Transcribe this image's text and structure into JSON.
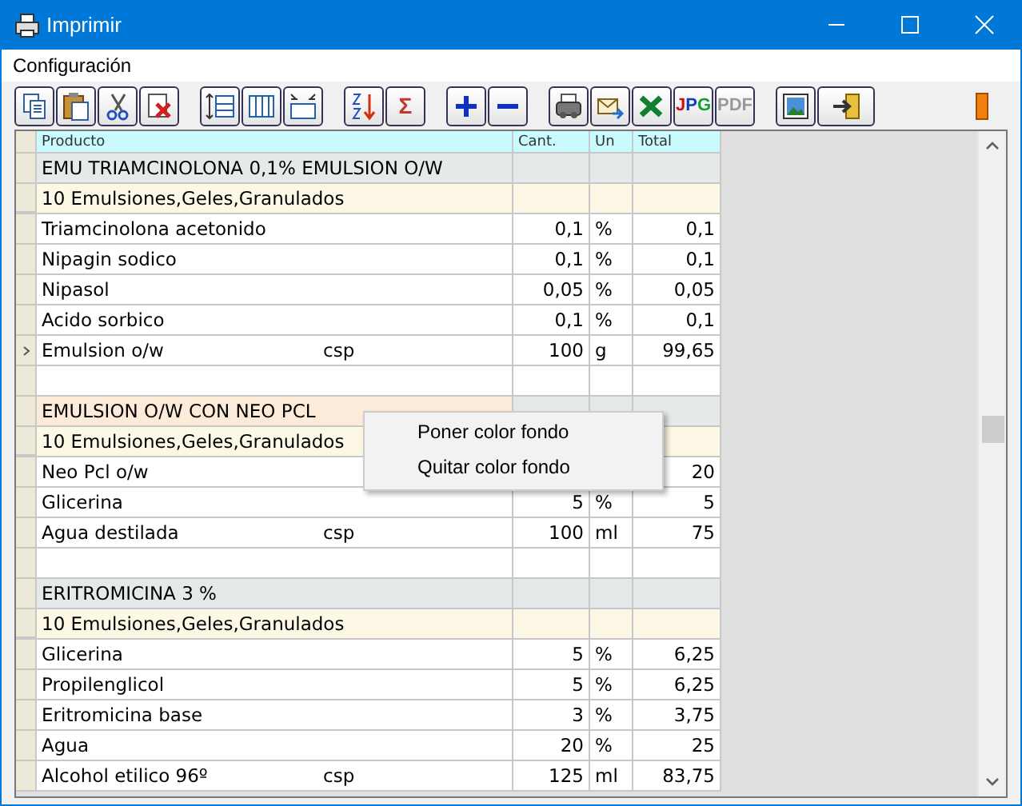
{
  "window": {
    "title": "Imprimir"
  },
  "menu": [
    {
      "label": "Configuración"
    }
  ],
  "toolbar": [
    {
      "buttons": [
        {
          "kind": "copy"
        },
        {
          "kind": "paste"
        },
        {
          "kind": "cut"
        },
        {
          "kind": "delete"
        }
      ]
    },
    {
      "buttons": [
        {
          "kind": "row-height"
        },
        {
          "kind": "columns"
        },
        {
          "kind": "fit"
        }
      ]
    },
    {
      "buttons": [
        {
          "kind": "sort"
        },
        {
          "kind": "sum",
          "label": "Σ"
        }
      ]
    },
    {
      "buttons": [
        {
          "kind": "plus"
        },
        {
          "kind": "minus"
        }
      ]
    },
    {
      "buttons": [
        {
          "kind": "printer"
        },
        {
          "kind": "mail"
        },
        {
          "kind": "excel"
        },
        {
          "kind": "jpg",
          "label": "JPG"
        },
        {
          "kind": "pdf",
          "label": "PDF"
        }
      ]
    },
    {
      "buttons": [
        {
          "kind": "image"
        },
        {
          "kind": "exit"
        }
      ]
    }
  ],
  "table": {
    "columns": [
      "Producto",
      "Cant.",
      "Un",
      "Total"
    ],
    "rows": [
      {
        "kind": "title",
        "product": "EMU TRIAMCINOLONA 0,1% EMULSION O/W",
        "color": "#e6e9e9"
      },
      {
        "kind": "category",
        "product": "10 Emulsiones,Geles,Granulados"
      },
      {
        "kind": "item",
        "product": "Triamcinolona acetonido",
        "qty": "0,1",
        "unit": "%",
        "total": "0,1",
        "current": false
      },
      {
        "kind": "item",
        "product": "Nipagin sodico",
        "qty": "0,1",
        "unit": "%",
        "total": "0,1",
        "current": false
      },
      {
        "kind": "item",
        "product": "Nipasol",
        "qty": "0,05",
        "unit": "%",
        "total": "0,05",
        "current": false
      },
      {
        "kind": "item",
        "product": "Acido sorbico",
        "qty": "0,1",
        "unit": "%",
        "total": "0,1",
        "current": false
      },
      {
        "kind": "item",
        "product": "Emulsion o/w",
        "note": "csp",
        "qty": "100",
        "unit": "g",
        "total": "99,65",
        "current": true
      },
      {
        "kind": "blank"
      },
      {
        "kind": "title",
        "product": "EMULSION O/W CON NEO PCL",
        "color": "#fdebd9"
      },
      {
        "kind": "category",
        "product": "10 Emulsiones,Geles,Granulados"
      },
      {
        "kind": "item",
        "product": "Neo Pcl o/w",
        "total": "20",
        "current": false
      },
      {
        "kind": "item",
        "product": "Glicerina",
        "qty": "5",
        "unit": "%",
        "total": "5",
        "current": false
      },
      {
        "kind": "item",
        "product": "Agua destilada",
        "note": "csp",
        "qty": "100",
        "unit": "ml",
        "total": "75",
        "current": false
      },
      {
        "kind": "blank"
      },
      {
        "kind": "title",
        "product": "ERITROMICINA 3 %",
        "color": "#e6e9e9"
      },
      {
        "kind": "category",
        "product": "10 Emulsiones,Geles,Granulados"
      },
      {
        "kind": "item",
        "product": "Glicerina",
        "qty": "5",
        "unit": "%",
        "total": "6,25",
        "current": false
      },
      {
        "kind": "item",
        "product": "Propilenglicol",
        "qty": "5",
        "unit": "%",
        "total": "6,25",
        "current": false
      },
      {
        "kind": "item",
        "product": "Eritromicina base",
        "qty": "3",
        "unit": "%",
        "total": "3,75",
        "current": false
      },
      {
        "kind": "item",
        "product": "Agua",
        "qty": "20",
        "unit": "%",
        "total": "25",
        "current": false
      },
      {
        "kind": "item",
        "product": "Alcohol etilico 96º",
        "note": "csp",
        "qty": "125",
        "unit": "ml",
        "total": "83,75",
        "current": false
      }
    ]
  },
  "context_menu": {
    "items": [
      {
        "label": "Poner color fondo"
      },
      {
        "label": "Quitar color fondo"
      }
    ]
  }
}
